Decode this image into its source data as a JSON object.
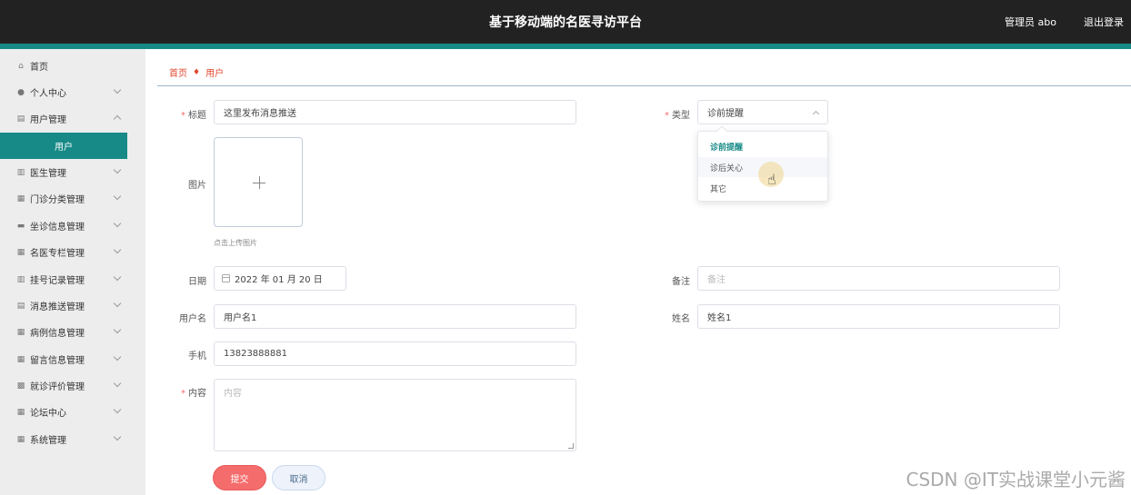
{
  "header": {
    "title": "基于移动端的名医寻访平台",
    "user": "管理员 abo",
    "logout": "退出登录"
  },
  "sidebar": {
    "items": [
      {
        "label": "首页",
        "icon": "home-icon",
        "has_children": false
      },
      {
        "label": "个人中心",
        "icon": "user-icon",
        "has_children": true
      },
      {
        "label": "用户管理",
        "icon": "clipboard-icon",
        "has_children": true
      },
      {
        "label": "医生管理",
        "icon": "bar-chart-icon",
        "has_children": true
      },
      {
        "label": "门诊分类管理",
        "icon": "grid-icon",
        "has_children": true
      },
      {
        "label": "坐诊信息管理",
        "icon": "stamp-icon",
        "has_children": true
      },
      {
        "label": "名医专栏管理",
        "icon": "grid-icon",
        "has_children": true
      },
      {
        "label": "挂号记录管理",
        "icon": "bar-chart-icon",
        "has_children": true
      },
      {
        "label": "消息推送管理",
        "icon": "clipboard-icon",
        "has_children": true
      },
      {
        "label": "病例信息管理",
        "icon": "grid-icon",
        "has_children": true
      },
      {
        "label": "留言信息管理",
        "icon": "grid-icon",
        "has_children": true
      },
      {
        "label": "就诊评价管理",
        "icon": "ticket-icon",
        "has_children": true
      },
      {
        "label": "论坛中心",
        "icon": "grid-icon",
        "has_children": true
      },
      {
        "label": "系统管理",
        "icon": "grid-icon",
        "has_children": true
      }
    ],
    "active_sub": "用户"
  },
  "breadcrumb": {
    "home": "首页",
    "current": "用户"
  },
  "form": {
    "title": {
      "label": "标题",
      "value": "这里发布消息推送"
    },
    "type": {
      "label": "类型",
      "value": "诊前提醒",
      "options": [
        "诊前提醒",
        "诊后关心",
        "其它"
      ]
    },
    "image": {
      "label": "图片",
      "tip": "点击上传图片"
    },
    "date": {
      "label": "日期",
      "value": "2022 年 01 月 20 日"
    },
    "note": {
      "label": "备注",
      "placeholder": "备注"
    },
    "username": {
      "label": "用户名",
      "value": "用户名1"
    },
    "name": {
      "label": "姓名",
      "value": "姓名1"
    },
    "phone": {
      "label": "手机",
      "value": "13823888881"
    },
    "content": {
      "label": "内容",
      "placeholder": "内容"
    },
    "submit": "提交",
    "cancel": "取消"
  },
  "watermark": "CSDN @IT实战课堂小元酱",
  "colors": {
    "accent": "#178a87",
    "danger": "#f56c6c",
    "breadcrumb": "#e0482e"
  }
}
